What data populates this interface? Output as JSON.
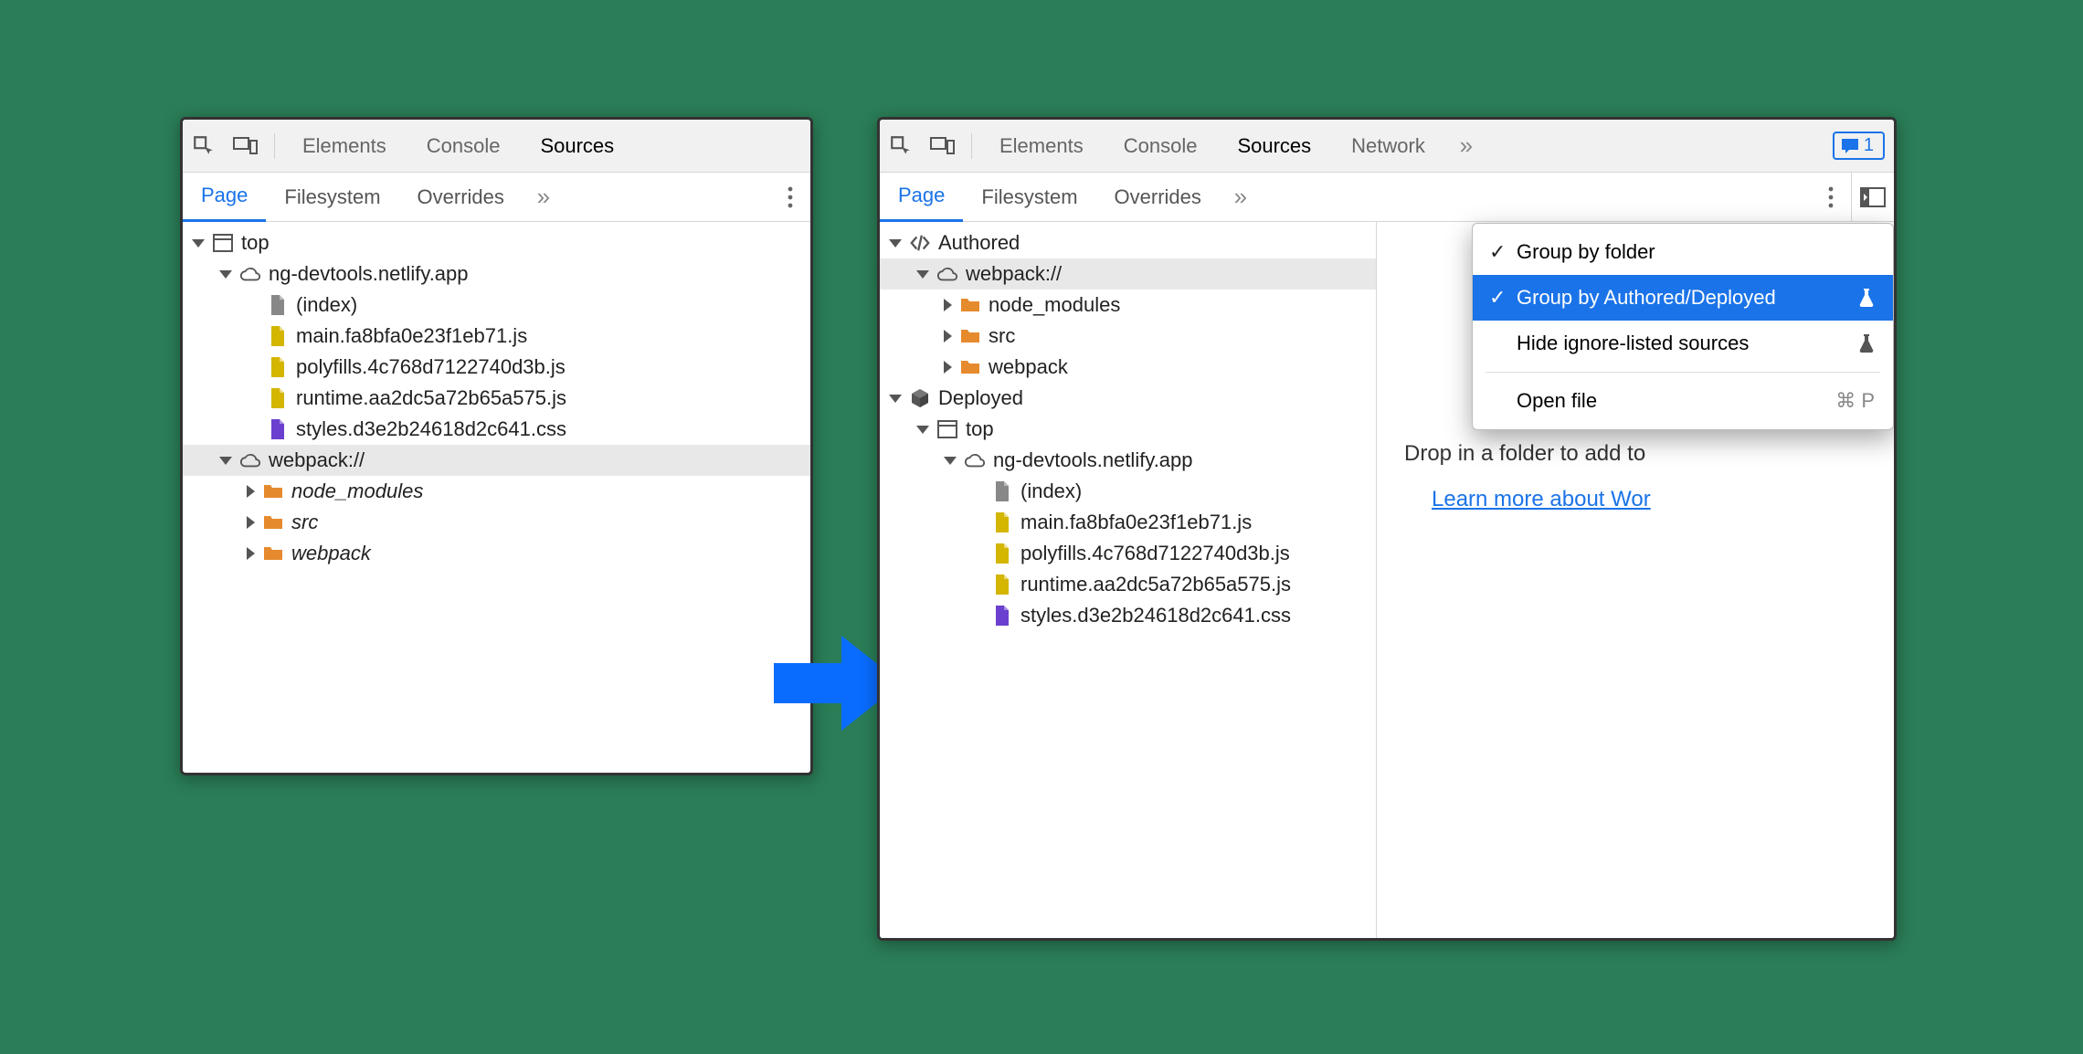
{
  "toolbar": {
    "tabs": [
      "Elements",
      "Console",
      "Sources",
      "Network"
    ],
    "active_tab": "Sources",
    "issues_count": "1"
  },
  "subbar": {
    "tabs": [
      "Page",
      "Filesystem",
      "Overrides"
    ],
    "active_tab": "Page"
  },
  "left_tree": {
    "rows": [
      {
        "arrow": "down",
        "icon": "frame",
        "label": "top",
        "indent": 1
      },
      {
        "arrow": "down",
        "icon": "cloud",
        "label": "ng-devtools.netlify.app",
        "indent": 2
      },
      {
        "arrow": "none",
        "icon": "doc-gray",
        "label": "(index)",
        "indent": 3
      },
      {
        "arrow": "none",
        "icon": "doc-js",
        "label": "main.fa8bfa0e23f1eb71.js",
        "indent": 3
      },
      {
        "arrow": "none",
        "icon": "doc-js",
        "label": "polyfills.4c768d7122740d3b.js",
        "indent": 3
      },
      {
        "arrow": "none",
        "icon": "doc-js",
        "label": "runtime.aa2dc5a72b65a575.js",
        "indent": 3
      },
      {
        "arrow": "none",
        "icon": "doc-css",
        "label": "styles.d3e2b24618d2c641.css",
        "indent": 3
      },
      {
        "arrow": "down",
        "icon": "cloud",
        "label": "webpack://",
        "indent": 2,
        "sel": true
      },
      {
        "arrow": "right",
        "icon": "folder",
        "label": "node_modules",
        "indent": 3,
        "italic": true
      },
      {
        "arrow": "right",
        "icon": "folder",
        "label": "src",
        "indent": 3,
        "italic": true
      },
      {
        "arrow": "right",
        "icon": "folder",
        "label": "webpack",
        "indent": 3,
        "italic": true
      }
    ]
  },
  "right_tree": {
    "rows": [
      {
        "arrow": "down",
        "icon": "code",
        "label": "Authored",
        "indent": 1
      },
      {
        "arrow": "down",
        "icon": "cloud",
        "label": "webpack://",
        "indent": 2,
        "sel": true
      },
      {
        "arrow": "right",
        "icon": "folder",
        "label": "node_modules",
        "indent": 3
      },
      {
        "arrow": "right",
        "icon": "folder",
        "label": "src",
        "indent": 3
      },
      {
        "arrow": "right",
        "icon": "folder",
        "label": "webpack",
        "indent": 3
      },
      {
        "arrow": "down",
        "icon": "cube",
        "label": "Deployed",
        "indent": 1
      },
      {
        "arrow": "down",
        "icon": "frame",
        "label": "top",
        "indent": 2
      },
      {
        "arrow": "down",
        "icon": "cloud",
        "label": "ng-devtools.netlify.app",
        "indent": 3
      },
      {
        "arrow": "none",
        "icon": "doc-gray",
        "label": "(index)",
        "indent": 4
      },
      {
        "arrow": "none",
        "icon": "doc-js",
        "label": "main.fa8bfa0e23f1eb71.js",
        "indent": 4
      },
      {
        "arrow": "none",
        "icon": "doc-js",
        "label": "polyfills.4c768d7122740d3b.js",
        "indent": 4
      },
      {
        "arrow": "none",
        "icon": "doc-js",
        "label": "runtime.aa2dc5a72b65a575.js",
        "indent": 4
      },
      {
        "arrow": "none",
        "icon": "doc-css",
        "label": "styles.d3e2b24618d2c641.css",
        "indent": 4
      }
    ]
  },
  "context_menu": {
    "items": [
      {
        "checked": true,
        "label": "Group by folder",
        "flask": false
      },
      {
        "checked": true,
        "label": "Group by Authored/Deployed",
        "flask": true,
        "hl": true
      },
      {
        "checked": false,
        "label": "Hide ignore-listed sources",
        "flask": true
      }
    ],
    "open_file_label": "Open file",
    "open_file_shortcut": "⌘ P"
  },
  "editor": {
    "drop_text": "Drop in a folder to add to",
    "learn_text": "Learn more about Wor"
  }
}
